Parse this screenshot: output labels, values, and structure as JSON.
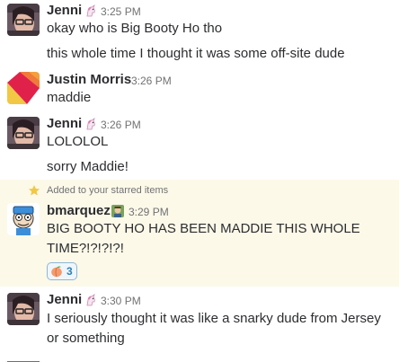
{
  "messages": [
    {
      "author": "Jenni",
      "time": "3:25 PM",
      "lines": [
        "okay who is Big Booty Ho tho",
        "this whole time I thought it was some off-site dude"
      ]
    },
    {
      "author": "Justin Morris",
      "time": "3:26 PM",
      "lines": [
        "maddie"
      ]
    },
    {
      "author": "Jenni",
      "time": "3:26 PM",
      "lines": [
        "LOLOLOL",
        "sorry Maddie!"
      ]
    },
    {
      "starred_note": "Added to your starred items",
      "author": "bmarquez",
      "time": "3:29 PM",
      "lines": [
        "BIG BOOTY HO HAS BEEN MADDIE THIS WHOLE TIME?!?!?!?!"
      ],
      "reaction": {
        "icon": "peach-emoji-icon",
        "count": "3"
      }
    },
    {
      "author": "Jenni",
      "time": "3:30 PM",
      "lines": [
        "I seriously thought it was like a snarky dude from Jersey or something"
      ]
    }
  ],
  "colors": {
    "starred_background": "#fcf9e9",
    "reaction_border": "#8fb6d6",
    "reaction_count": "#2a80b9",
    "timestamp": "#717274",
    "star": "#f2c744"
  },
  "icons": {
    "jenni_status": "unicorn-icon",
    "bmarquez_status": "person-emoji-icon",
    "star": "star-icon"
  }
}
